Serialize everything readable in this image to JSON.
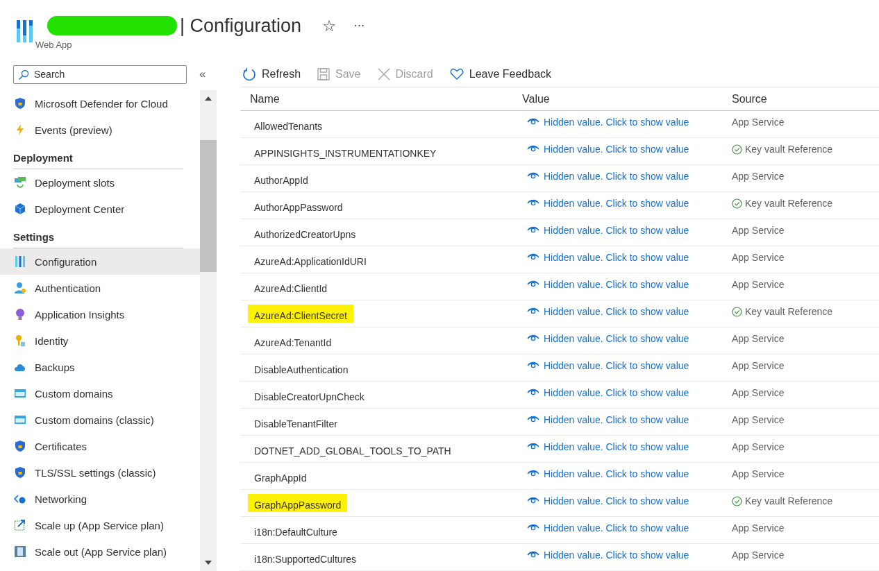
{
  "header": {
    "title": "| Configuration",
    "subtitle": "Web App",
    "more": "···",
    "favorite": "☆"
  },
  "search": {
    "placeholder": "Search"
  },
  "collapse": "«",
  "sidebar": [
    {
      "kind": "item",
      "label": "Microsoft Defender for Cloud",
      "selected": false
    },
    {
      "kind": "item",
      "label": "Events (preview)",
      "selected": false
    },
    {
      "kind": "heading",
      "label": "Deployment"
    },
    {
      "kind": "item",
      "label": "Deployment slots",
      "selected": false
    },
    {
      "kind": "item",
      "label": "Deployment Center",
      "selected": false
    },
    {
      "kind": "heading",
      "label": "Settings"
    },
    {
      "kind": "item",
      "label": "Configuration",
      "selected": true
    },
    {
      "kind": "item",
      "label": "Authentication",
      "selected": false
    },
    {
      "kind": "item",
      "label": "Application Insights",
      "selected": false
    },
    {
      "kind": "item",
      "label": "Identity",
      "selected": false
    },
    {
      "kind": "item",
      "label": "Backups",
      "selected": false
    },
    {
      "kind": "item",
      "label": "Custom domains",
      "selected": false
    },
    {
      "kind": "item",
      "label": "Custom domains (classic)",
      "selected": false
    },
    {
      "kind": "item",
      "label": "Certificates",
      "selected": false
    },
    {
      "kind": "item",
      "label": "TLS/SSL settings (classic)",
      "selected": false
    },
    {
      "kind": "item",
      "label": "Networking",
      "selected": false
    },
    {
      "kind": "item",
      "label": "Scale up (App Service plan)",
      "selected": false
    },
    {
      "kind": "item",
      "label": "Scale out (App Service plan)",
      "selected": false
    }
  ],
  "toolbar": [
    {
      "label": "Refresh",
      "disabled": false
    },
    {
      "label": "Save",
      "disabled": true
    },
    {
      "label": "Discard",
      "disabled": true
    },
    {
      "label": "Leave Feedback",
      "disabled": false
    }
  ],
  "table": {
    "columns": [
      "Name",
      "Value",
      "Source"
    ],
    "rows": [
      {
        "name": "AllowedTenants",
        "value": "Hidden value. Click to show value",
        "source": "App Service",
        "kind": "app",
        "highlighted": false
      },
      {
        "name": "APPINSIGHTS_INSTRUMENTATIONKEY",
        "value": "Hidden value. Click to show value",
        "source": "Key vault Reference",
        "kind": "keyvault",
        "highlighted": false
      },
      {
        "name": "AuthorAppId",
        "value": "Hidden value. Click to show value",
        "source": "App Service",
        "kind": "app",
        "highlighted": false
      },
      {
        "name": "AuthorAppPassword",
        "value": "Hidden value. Click to show value",
        "source": "Key vault Reference",
        "kind": "keyvault",
        "highlighted": false
      },
      {
        "name": "AuthorizedCreatorUpns",
        "value": "Hidden value. Click to show value",
        "source": "App Service",
        "kind": "app",
        "highlighted": false
      },
      {
        "name": "AzureAd:ApplicationIdURI",
        "value": "Hidden value. Click to show value",
        "source": "App Service",
        "kind": "app",
        "highlighted": false
      },
      {
        "name": "AzureAd:ClientId",
        "value": "Hidden value. Click to show value",
        "source": "App Service",
        "kind": "app",
        "highlighted": false
      },
      {
        "name": "AzureAd:ClientSecret",
        "value": "Hidden value. Click to show value",
        "source": "Key vault Reference",
        "kind": "keyvault",
        "highlighted": true
      },
      {
        "name": "AzureAd:TenantId",
        "value": "Hidden value. Click to show value",
        "source": "App Service",
        "kind": "app",
        "highlighted": false
      },
      {
        "name": "DisableAuthentication",
        "value": "Hidden value. Click to show value",
        "source": "App Service",
        "kind": "app",
        "highlighted": false
      },
      {
        "name": "DisableCreatorUpnCheck",
        "value": "Hidden value. Click to show value",
        "source": "App Service",
        "kind": "app",
        "highlighted": false
      },
      {
        "name": "DisableTenantFilter",
        "value": "Hidden value. Click to show value",
        "source": "App Service",
        "kind": "app",
        "highlighted": false
      },
      {
        "name": "DOTNET_ADD_GLOBAL_TOOLS_TO_PATH",
        "value": "Hidden value. Click to show value",
        "source": "App Service",
        "kind": "app",
        "highlighted": false
      },
      {
        "name": "GraphAppId",
        "value": "Hidden value. Click to show value",
        "source": "App Service",
        "kind": "app",
        "highlighted": false
      },
      {
        "name": "GraphAppPassword",
        "value": "Hidden value. Click to show value",
        "source": "Key vault Reference",
        "kind": "keyvault",
        "highlighted": true
      },
      {
        "name": "i18n:DefaultCulture",
        "value": "Hidden value. Click to show value",
        "source": "App Service",
        "kind": "app",
        "highlighted": false
      },
      {
        "name": "i18n:SupportedCultures",
        "value": "Hidden value. Click to show value",
        "source": "App Service",
        "kind": "app",
        "highlighted": false
      }
    ]
  }
}
